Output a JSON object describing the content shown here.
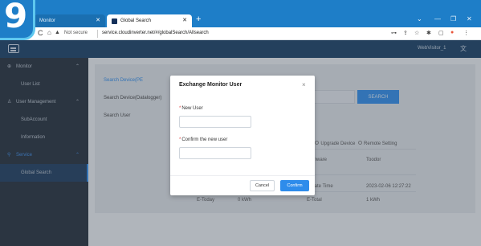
{
  "step_number": "9",
  "browser": {
    "tabs": [
      {
        "label": "Monitor"
      },
      {
        "label": "Global Search"
      }
    ],
    "new_tab": "+",
    "window_controls": {
      "minimize": "—",
      "maximize": "❐",
      "close": "✕",
      "dropdown": "⌄"
    },
    "address": {
      "not_secure": "Not secure",
      "url": "service.cloudinverter.net/#/globalSearch/Allsearch"
    }
  },
  "app": {
    "user": "WebVisitor_1",
    "lang_icon": "translate-icon"
  },
  "sidebar": {
    "items": [
      {
        "label": "Monitor",
        "icon": "monitor-icon",
        "chevron": "⌃"
      },
      {
        "label": "User List"
      },
      {
        "label": "User Management",
        "icon": "user-icon",
        "chevron": "⌃"
      },
      {
        "label": "SubAccount"
      },
      {
        "label": "Information"
      },
      {
        "label": "Service",
        "icon": "search-icon",
        "chevron": "⌃"
      },
      {
        "label": "Global Search"
      }
    ]
  },
  "subnav": {
    "items": [
      "Search Device(PE",
      "Search Device(Datalogger)",
      "Search User"
    ]
  },
  "main": {
    "search_button": "SEARCH",
    "actions": {
      "prefix": "ice",
      "upgrade": "Upgrade Device",
      "remote": "Remote Setting"
    },
    "rows": [
      {
        "left": "",
        "right_label": "Firmware",
        "right_value": "Toodor"
      },
      {
        "left_label": "",
        "left_value": "",
        "right_label": "Create Time",
        "right_value": "2023-02-06 12:27:22"
      },
      {
        "left_label": "E-Today",
        "left_value": "0 kWh",
        "right_label": "E-Total",
        "right_value": "1 kWh"
      }
    ]
  },
  "modal": {
    "title": "Exchange Monitor User",
    "close": "×",
    "new_user_label": "New User",
    "new_user_value": "",
    "confirm_label": "Confirm the new user",
    "confirm_value": "",
    "required_mark": "*",
    "cancel": "Cancel",
    "confirm": "Confirm"
  }
}
